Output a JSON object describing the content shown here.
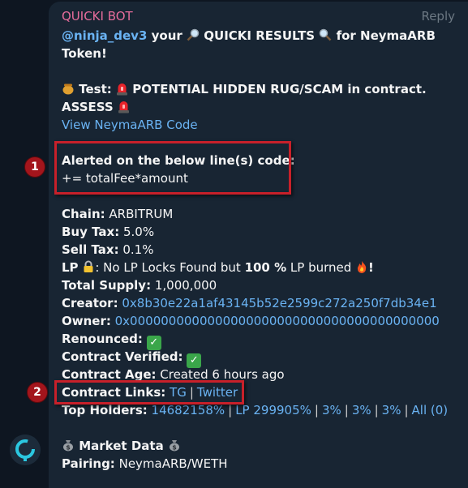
{
  "message": {
    "sender": "QUICKI BOT",
    "reply_label": "Reply",
    "mention": "@ninja_dev3",
    "intro_your": "your",
    "results_label": "QUICKI RESULTS",
    "intro_for": "for NeymaARB",
    "intro_token": "Token!",
    "test_label": "Test:",
    "test_result": "POTENTIAL HIDDEN RUG/SCAM in contract.",
    "assess": "ASSESS",
    "view_code_link": "View NeymaARB Code",
    "alert_title": "Alerted on the below line(s) code:",
    "alert_code": "+= totalFee*amount",
    "chain_label": "Chain:",
    "chain_value": "ARBITRUM",
    "buy_tax_label": "Buy Tax:",
    "buy_tax_value": "5.0%",
    "sell_tax_label": "Sell Tax:",
    "sell_tax_value": "0.1%",
    "lp_label": "LP",
    "lp_text_a": ": No LP Locks Found but",
    "lp_percent": "100 %",
    "lp_text_b": "LP burned",
    "lp_exclaim": "!",
    "supply_label": "Total Supply:",
    "supply_value": "1,000,000",
    "creator_label": "Creator:",
    "creator_value": "0x8b30e22a1af43145b52e2599c272a250f7db34e1",
    "owner_label": "Owner:",
    "owner_value": "0x0000000000000000000000000000000000000000",
    "renounced_label": "Renounced:",
    "verified_label": "Contract Verified:",
    "age_label": "Contract Age:",
    "age_value": "Created 6 hours ago",
    "links_label": "Contract Links:",
    "link_tg": "TG",
    "link_twitter": "Twitter",
    "holders_label": "Top Holders:",
    "holder_1": "14682158%",
    "holder_2": "LP 299905%",
    "holder_3": "3%",
    "holder_4": "3%",
    "holder_5": "3%",
    "holder_all": "All (0)",
    "market_title": "Market Data",
    "pairing_label": "Pairing:",
    "pairing_value": "NeymaARB/WETH"
  },
  "annotations": {
    "badge_1": "1",
    "badge_2": "2"
  },
  "colors": {
    "background": "#0e1621",
    "bubble": "#182533",
    "sender": "#e76d9c",
    "link": "#6ab3f3",
    "highlight": "#c8202a"
  },
  "icons": [
    "magnifier-icon",
    "honey-pot-icon",
    "siren-icon",
    "lock-icon",
    "fire-icon",
    "check-icon",
    "money-bag-icon"
  ]
}
